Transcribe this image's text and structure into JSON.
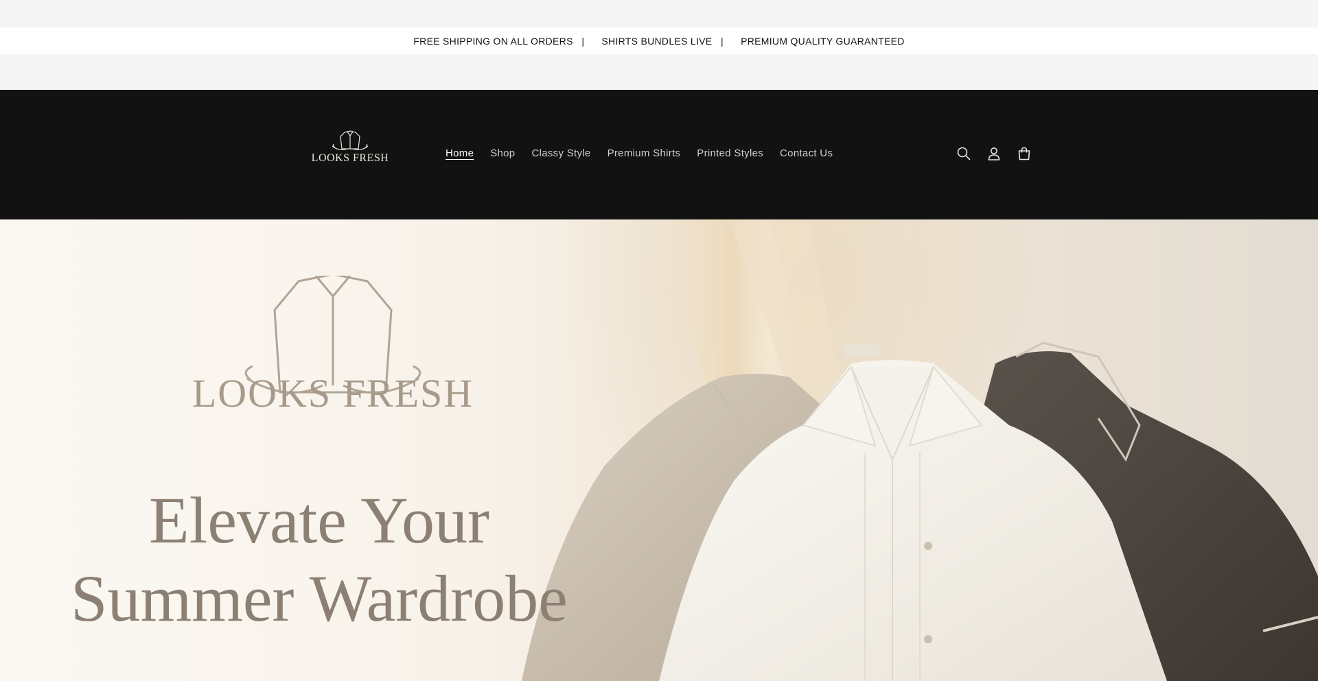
{
  "announcement": {
    "items": [
      "FREE SHIPPING ON ALL ORDERS",
      "SHIRTS BUNDLES LIVE",
      "PREMIUM QUALITY GUARANTEED"
    ],
    "separator": "|"
  },
  "header": {
    "logo_text": "LOOKS FRESH",
    "nav": [
      {
        "label": "Home",
        "active": true
      },
      {
        "label": "Shop"
      },
      {
        "label": "Classy Style"
      },
      {
        "label": "Premium Shirts"
      },
      {
        "label": "Printed Styles"
      },
      {
        "label": "Contact Us"
      }
    ],
    "icons": [
      "search-icon",
      "account-icon",
      "cart-icon"
    ],
    "background_color": "#121212"
  },
  "hero": {
    "brand": "LOOKS FRESH",
    "heading_line1": "Elevate Your",
    "heading_line2": "Summer Wardrobe",
    "text_color": "#8c8074"
  }
}
